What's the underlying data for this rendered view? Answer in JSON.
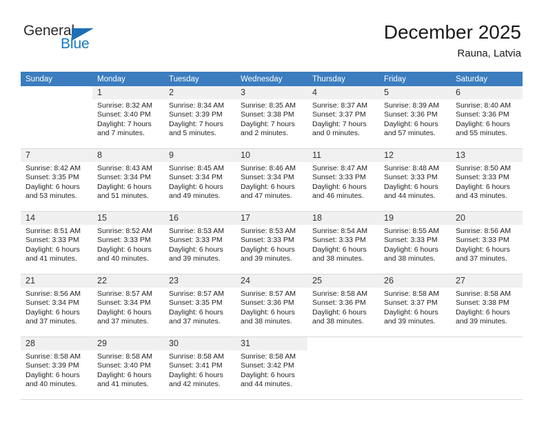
{
  "brand": {
    "name_part1": "General",
    "name_part2": "Blue",
    "flag_icon": "triangle-flag-icon"
  },
  "header": {
    "title": "December 2025",
    "subtitle": "Rauna, Latvia"
  },
  "colors": {
    "header_band": "#3b7dbf",
    "day_band": "#f0f0f0",
    "brand_blue": "#1678c2",
    "grid_line": "#d9d9d9"
  },
  "weekdays": [
    "Sunday",
    "Monday",
    "Tuesday",
    "Wednesday",
    "Thursday",
    "Friday",
    "Saturday"
  ],
  "weeks": [
    [
      {
        "day": "",
        "sunrise": "",
        "sunset": "",
        "daylight_l1": "",
        "daylight_l2": ""
      },
      {
        "day": "1",
        "sunrise": "Sunrise: 8:32 AM",
        "sunset": "Sunset: 3:40 PM",
        "daylight_l1": "Daylight: 7 hours",
        "daylight_l2": "and 7 minutes."
      },
      {
        "day": "2",
        "sunrise": "Sunrise: 8:34 AM",
        "sunset": "Sunset: 3:39 PM",
        "daylight_l1": "Daylight: 7 hours",
        "daylight_l2": "and 5 minutes."
      },
      {
        "day": "3",
        "sunrise": "Sunrise: 8:35 AM",
        "sunset": "Sunset: 3:38 PM",
        "daylight_l1": "Daylight: 7 hours",
        "daylight_l2": "and 2 minutes."
      },
      {
        "day": "4",
        "sunrise": "Sunrise: 8:37 AM",
        "sunset": "Sunset: 3:37 PM",
        "daylight_l1": "Daylight: 7 hours",
        "daylight_l2": "and 0 minutes."
      },
      {
        "day": "5",
        "sunrise": "Sunrise: 8:39 AM",
        "sunset": "Sunset: 3:36 PM",
        "daylight_l1": "Daylight: 6 hours",
        "daylight_l2": "and 57 minutes."
      },
      {
        "day": "6",
        "sunrise": "Sunrise: 8:40 AM",
        "sunset": "Sunset: 3:36 PM",
        "daylight_l1": "Daylight: 6 hours",
        "daylight_l2": "and 55 minutes."
      }
    ],
    [
      {
        "day": "7",
        "sunrise": "Sunrise: 8:42 AM",
        "sunset": "Sunset: 3:35 PM",
        "daylight_l1": "Daylight: 6 hours",
        "daylight_l2": "and 53 minutes."
      },
      {
        "day": "8",
        "sunrise": "Sunrise: 8:43 AM",
        "sunset": "Sunset: 3:34 PM",
        "daylight_l1": "Daylight: 6 hours",
        "daylight_l2": "and 51 minutes."
      },
      {
        "day": "9",
        "sunrise": "Sunrise: 8:45 AM",
        "sunset": "Sunset: 3:34 PM",
        "daylight_l1": "Daylight: 6 hours",
        "daylight_l2": "and 49 minutes."
      },
      {
        "day": "10",
        "sunrise": "Sunrise: 8:46 AM",
        "sunset": "Sunset: 3:34 PM",
        "daylight_l1": "Daylight: 6 hours",
        "daylight_l2": "and 47 minutes."
      },
      {
        "day": "11",
        "sunrise": "Sunrise: 8:47 AM",
        "sunset": "Sunset: 3:33 PM",
        "daylight_l1": "Daylight: 6 hours",
        "daylight_l2": "and 46 minutes."
      },
      {
        "day": "12",
        "sunrise": "Sunrise: 8:48 AM",
        "sunset": "Sunset: 3:33 PM",
        "daylight_l1": "Daylight: 6 hours",
        "daylight_l2": "and 44 minutes."
      },
      {
        "day": "13",
        "sunrise": "Sunrise: 8:50 AM",
        "sunset": "Sunset: 3:33 PM",
        "daylight_l1": "Daylight: 6 hours",
        "daylight_l2": "and 43 minutes."
      }
    ],
    [
      {
        "day": "14",
        "sunrise": "Sunrise: 8:51 AM",
        "sunset": "Sunset: 3:33 PM",
        "daylight_l1": "Daylight: 6 hours",
        "daylight_l2": "and 41 minutes."
      },
      {
        "day": "15",
        "sunrise": "Sunrise: 8:52 AM",
        "sunset": "Sunset: 3:33 PM",
        "daylight_l1": "Daylight: 6 hours",
        "daylight_l2": "and 40 minutes."
      },
      {
        "day": "16",
        "sunrise": "Sunrise: 8:53 AM",
        "sunset": "Sunset: 3:33 PM",
        "daylight_l1": "Daylight: 6 hours",
        "daylight_l2": "and 39 minutes."
      },
      {
        "day": "17",
        "sunrise": "Sunrise: 8:53 AM",
        "sunset": "Sunset: 3:33 PM",
        "daylight_l1": "Daylight: 6 hours",
        "daylight_l2": "and 39 minutes."
      },
      {
        "day": "18",
        "sunrise": "Sunrise: 8:54 AM",
        "sunset": "Sunset: 3:33 PM",
        "daylight_l1": "Daylight: 6 hours",
        "daylight_l2": "and 38 minutes."
      },
      {
        "day": "19",
        "sunrise": "Sunrise: 8:55 AM",
        "sunset": "Sunset: 3:33 PM",
        "daylight_l1": "Daylight: 6 hours",
        "daylight_l2": "and 38 minutes."
      },
      {
        "day": "20",
        "sunrise": "Sunrise: 8:56 AM",
        "sunset": "Sunset: 3:33 PM",
        "daylight_l1": "Daylight: 6 hours",
        "daylight_l2": "and 37 minutes."
      }
    ],
    [
      {
        "day": "21",
        "sunrise": "Sunrise: 8:56 AM",
        "sunset": "Sunset: 3:34 PM",
        "daylight_l1": "Daylight: 6 hours",
        "daylight_l2": "and 37 minutes."
      },
      {
        "day": "22",
        "sunrise": "Sunrise: 8:57 AM",
        "sunset": "Sunset: 3:34 PM",
        "daylight_l1": "Daylight: 6 hours",
        "daylight_l2": "and 37 minutes."
      },
      {
        "day": "23",
        "sunrise": "Sunrise: 8:57 AM",
        "sunset": "Sunset: 3:35 PM",
        "daylight_l1": "Daylight: 6 hours",
        "daylight_l2": "and 37 minutes."
      },
      {
        "day": "24",
        "sunrise": "Sunrise: 8:57 AM",
        "sunset": "Sunset: 3:36 PM",
        "daylight_l1": "Daylight: 6 hours",
        "daylight_l2": "and 38 minutes."
      },
      {
        "day": "25",
        "sunrise": "Sunrise: 8:58 AM",
        "sunset": "Sunset: 3:36 PM",
        "daylight_l1": "Daylight: 6 hours",
        "daylight_l2": "and 38 minutes."
      },
      {
        "day": "26",
        "sunrise": "Sunrise: 8:58 AM",
        "sunset": "Sunset: 3:37 PM",
        "daylight_l1": "Daylight: 6 hours",
        "daylight_l2": "and 39 minutes."
      },
      {
        "day": "27",
        "sunrise": "Sunrise: 8:58 AM",
        "sunset": "Sunset: 3:38 PM",
        "daylight_l1": "Daylight: 6 hours",
        "daylight_l2": "and 39 minutes."
      }
    ],
    [
      {
        "day": "28",
        "sunrise": "Sunrise: 8:58 AM",
        "sunset": "Sunset: 3:39 PM",
        "daylight_l1": "Daylight: 6 hours",
        "daylight_l2": "and 40 minutes."
      },
      {
        "day": "29",
        "sunrise": "Sunrise: 8:58 AM",
        "sunset": "Sunset: 3:40 PM",
        "daylight_l1": "Daylight: 6 hours",
        "daylight_l2": "and 41 minutes."
      },
      {
        "day": "30",
        "sunrise": "Sunrise: 8:58 AM",
        "sunset": "Sunset: 3:41 PM",
        "daylight_l1": "Daylight: 6 hours",
        "daylight_l2": "and 42 minutes."
      },
      {
        "day": "31",
        "sunrise": "Sunrise: 8:58 AM",
        "sunset": "Sunset: 3:42 PM",
        "daylight_l1": "Daylight: 6 hours",
        "daylight_l2": "and 44 minutes."
      },
      {
        "day": "",
        "sunrise": "",
        "sunset": "",
        "daylight_l1": "",
        "daylight_l2": ""
      },
      {
        "day": "",
        "sunrise": "",
        "sunset": "",
        "daylight_l1": "",
        "daylight_l2": ""
      },
      {
        "day": "",
        "sunrise": "",
        "sunset": "",
        "daylight_l1": "",
        "daylight_l2": ""
      }
    ]
  ]
}
